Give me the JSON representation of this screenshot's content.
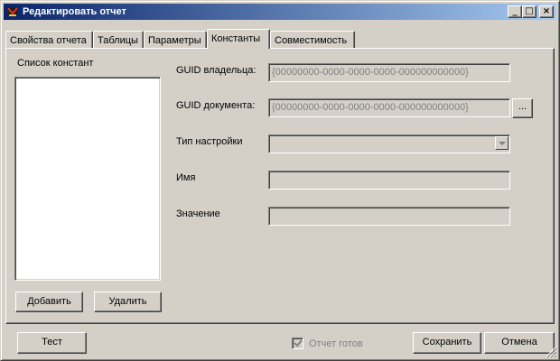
{
  "window": {
    "title": "Редактировать отчет",
    "minimize_glyph": "_",
    "maximize_glyph": "□",
    "close_glyph": "×"
  },
  "tabs": [
    {
      "label": "Свойства отчета",
      "active": false
    },
    {
      "label": "Таблицы",
      "active": false
    },
    {
      "label": "Параметры",
      "active": false
    },
    {
      "label": "Константы",
      "active": true
    },
    {
      "label": "Совместимость",
      "active": false
    }
  ],
  "constants": {
    "list_label": "Список констант",
    "add_button": "Добавить",
    "delete_button": "Удалить",
    "owner_guid_label": "GUID владельца:",
    "owner_guid_value": "{00000000-0000-0000-0000-000000000000}",
    "doc_guid_label": "GUID документа:",
    "doc_guid_value": "{00000000-0000-0000-0000-000000000000}",
    "browse_button": "...",
    "setting_type_label": "Тип настройки",
    "setting_type_value": "",
    "name_label": "Имя",
    "name_value": "",
    "value_label": "Значение",
    "value_value": ""
  },
  "footer": {
    "test_button": "Тест",
    "ready_label": "Отчет готов",
    "ready_checked": true,
    "save_button": "Сохранить",
    "cancel_button": "Отмена"
  },
  "colors": {
    "face": "#d4d0c8",
    "title_start": "#0a246a",
    "title_end": "#a6caf0",
    "disabled_text": "#808080"
  },
  "icons": {
    "app": "app-icon",
    "combo": "chevron-down-icon",
    "check": "checkmark-icon",
    "grip": "resize-grip-icon"
  }
}
